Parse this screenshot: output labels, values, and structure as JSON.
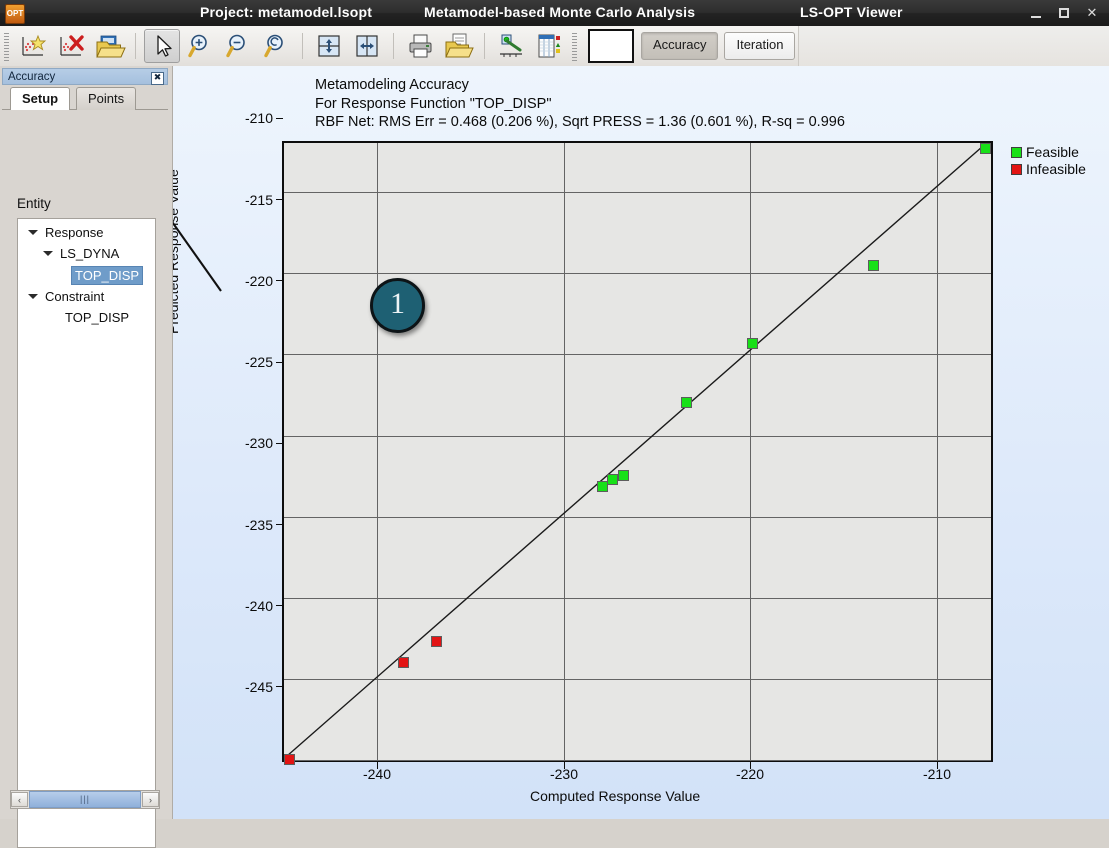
{
  "titlebar": {
    "logo": "app-logo",
    "project": "Project: metamodel.lsopt",
    "analysis": "Metamodel-based Monte Carlo Analysis",
    "viewer": "LS-OPT Viewer",
    "minimize": "–",
    "maximize": "□",
    "close": "✕"
  },
  "toolbar": {
    "buttons": [
      {
        "name": "add-plot-icon",
        "label": ""
      },
      {
        "name": "delete-plot-icon",
        "label": ""
      },
      {
        "name": "open-folder-icon",
        "label": ""
      },
      {
        "name": "pointer-icon",
        "label": ""
      },
      {
        "name": "zoom-in-icon",
        "label": ""
      },
      {
        "name": "zoom-out-icon",
        "label": ""
      },
      {
        "name": "zoom-reset-icon",
        "label": ""
      },
      {
        "name": "split-horizontal-icon",
        "label": ""
      },
      {
        "name": "split-vertical-icon",
        "label": ""
      },
      {
        "name": "print-icon",
        "label": ""
      },
      {
        "name": "save-as-icon",
        "label": ""
      },
      {
        "name": "curve-settings-icon",
        "label": ""
      },
      {
        "name": "table-view-icon",
        "label": ""
      }
    ],
    "color_swatch": "#ffffff",
    "tab_accuracy": "Accuracy",
    "tab_iteration": "Iteration",
    "active_tab": "Accuracy"
  },
  "sidebar": {
    "panel_title": "Accuracy",
    "panel_close": "✖",
    "tabs": [
      {
        "label": "Setup",
        "active": true
      },
      {
        "label": "Points",
        "active": false
      }
    ],
    "entity_label": "Entity",
    "tree": [
      {
        "label": "Response",
        "depth": 0,
        "expander": true,
        "selected": false
      },
      {
        "label": "LS_DYNA",
        "depth": 1,
        "expander": true,
        "selected": false
      },
      {
        "label": "TOP_DISP",
        "depth": 2,
        "expander": false,
        "selected": true
      },
      {
        "label": "Constraint",
        "depth": 0,
        "expander": true,
        "selected": false
      },
      {
        "label": "TOP_DISP",
        "depth": 1,
        "expander": false,
        "selected": false
      }
    ],
    "scroll_left": "‹",
    "scroll_right": "›",
    "scroll_thumb": "|||"
  },
  "callout": {
    "number": "1"
  },
  "chart_data": {
    "type": "scatter",
    "title": "Metamodeling Accuracy",
    "subtitle": "For Response Function \"TOP_DISP\"",
    "stats_line": "RBF Net: RMS Err = 0.468  (0.206 %),  Sqrt PRESS = 1.36   (0.601 %),  R-sq = 0.996",
    "xlabel": "Computed Response Value",
    "ylabel": "Predicted Response Value",
    "xlim": [
      -245.1,
      -207.0
    ],
    "ylim": [
      -245.2,
      -207.2
    ],
    "xticks": [
      -240,
      -230,
      -220,
      -210
    ],
    "yticks": [
      -210,
      -215,
      -220,
      -225,
      -230,
      -235,
      -240,
      -245
    ],
    "grid": true,
    "legend_position": "top-right",
    "legend": [
      {
        "label": "Feasible",
        "color": "#18e018"
      },
      {
        "label": "Infeasible",
        "color": "#e21414"
      }
    ],
    "reference_line": {
      "type": "y=x",
      "color": "#1a1a1a"
    },
    "series": [
      {
        "name": "Feasible",
        "color": "#18e018",
        "points": [
          {
            "x": -228.1,
            "y": -227.8
          },
          {
            "x": -227.6,
            "y": -227.4
          },
          {
            "x": -227.0,
            "y": -227.2
          },
          {
            "x": -223.6,
            "y": -222.9
          },
          {
            "x": -220.0,
            "y": -220.2
          },
          {
            "x": -213.5,
            "y": -214.4
          },
          {
            "x": -207.5,
            "y": -207.4
          }
        ]
      },
      {
        "name": "Infeasible",
        "color": "#e21414",
        "points": [
          {
            "x": -244.8,
            "y": -244.9
          },
          {
            "x": -238.7,
            "y": -238.9
          },
          {
            "x": -237.0,
            "y": -237.3
          }
        ]
      }
    ]
  }
}
